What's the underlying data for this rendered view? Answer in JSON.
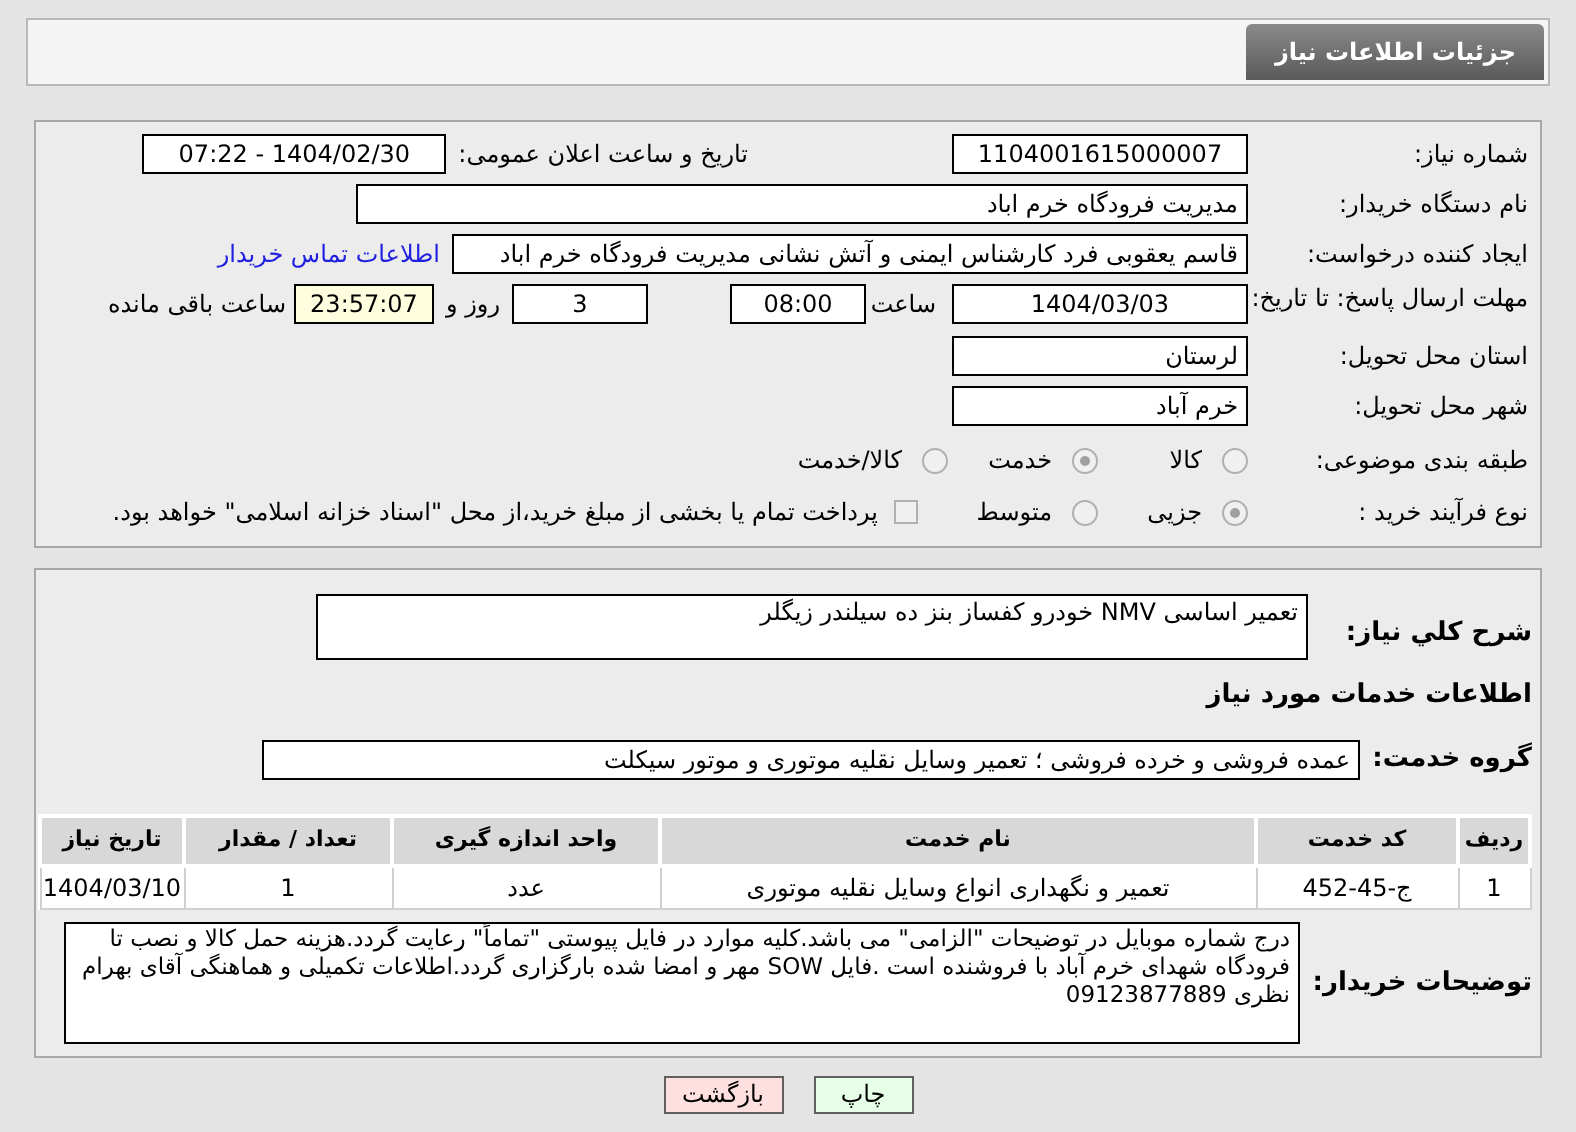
{
  "header": {
    "title": "جزئیات اطلاعات نیاز"
  },
  "need_number": {
    "label": "شماره نیاز:",
    "value": "1104001615000007"
  },
  "announce": {
    "label": "تاریخ و ساعت اعلان عمومی:",
    "value": "1404/02/30 - 07:22"
  },
  "buyer": {
    "label": "نام دستگاه خریدار:",
    "value": "مدیریت فرودگاه خرم اباد"
  },
  "requester": {
    "label": "ایجاد کننده درخواست:",
    "value": "قاسم یعقوبی فرد کارشناس ایمنی و آتش نشانی مدیریت فرودگاه خرم اباد",
    "link": "اطلاعات تماس خریدار"
  },
  "deadline": {
    "label": "مهلت ارسال پاسخ: تا تاریخ:",
    "date": "1404/03/03",
    "time_label": "ساعت",
    "time": "08:00",
    "days": "3",
    "days_label": "روز و",
    "remaining": "23:57:07",
    "remaining_label": "ساعت باقی مانده"
  },
  "province": {
    "label": "استان محل تحویل:",
    "value": "لرستان"
  },
  "city": {
    "label": "شهر محل تحویل:",
    "value": "خرم آباد"
  },
  "category": {
    "label": "طبقه بندی موضوعی:",
    "options": [
      {
        "label": "کالا",
        "selected": false
      },
      {
        "label": "خدمت",
        "selected": true
      },
      {
        "label": "کالا/خدمت",
        "selected": false
      }
    ]
  },
  "process": {
    "label": "نوع فرآیند خرید :",
    "options": [
      {
        "label": "جزیی",
        "selected": true
      },
      {
        "label": "متوسط",
        "selected": false
      }
    ],
    "payment": {
      "label": "پرداخت تمام یا بخشی از مبلغ خرید،از محل \"اسناد خزانه اسلامی\" خواهد بود.",
      "checked": false
    }
  },
  "summary": {
    "label": "شرح کلي نياز:",
    "value": "تعمیر اساسی NMV خودرو کفساز بنز ده سیلندر زیگلر"
  },
  "services_title": "اطلاعات خدمات مورد نیاز",
  "service_group": {
    "label": "گروه خدمت:",
    "value": "عمده فروشی و خرده فروشی ؛ تعمیر وسایل نقلیه موتوری و موتور سیکلت"
  },
  "table": {
    "columns": [
      "ردیف",
      "کد خدمت",
      "نام خدمت",
      "واحد اندازه گیری",
      "تعداد / مقدار",
      "تاریخ نیاز"
    ],
    "rows": [
      [
        "1",
        "ج-45-452",
        "تعمیر و نگهداری انواع وسایل نقلیه موتوری",
        "عدد",
        "1",
        "1404/03/10"
      ]
    ]
  },
  "buyer_notes": {
    "label": "توضیحات خریدار:",
    "value": "درج شماره موبایل در توضیحات \"الزامی\" می باشد.کلیه موارد در فایل پیوستی  \"تماماً\" رعایت گردد.هزینه حمل کالا و نصب تا فرودگاه شهدای خرم آباد با فروشنده است .فایل SOW مهر و امضا شده بارگزاری گردد.اطلاعات تکمیلی و هماهنگی آقای بهرام نظری 09123877889"
  },
  "buttons": [
    {
      "label": "چاپ",
      "kind": "print"
    },
    {
      "label": "بازگشت",
      "kind": "back"
    }
  ]
}
